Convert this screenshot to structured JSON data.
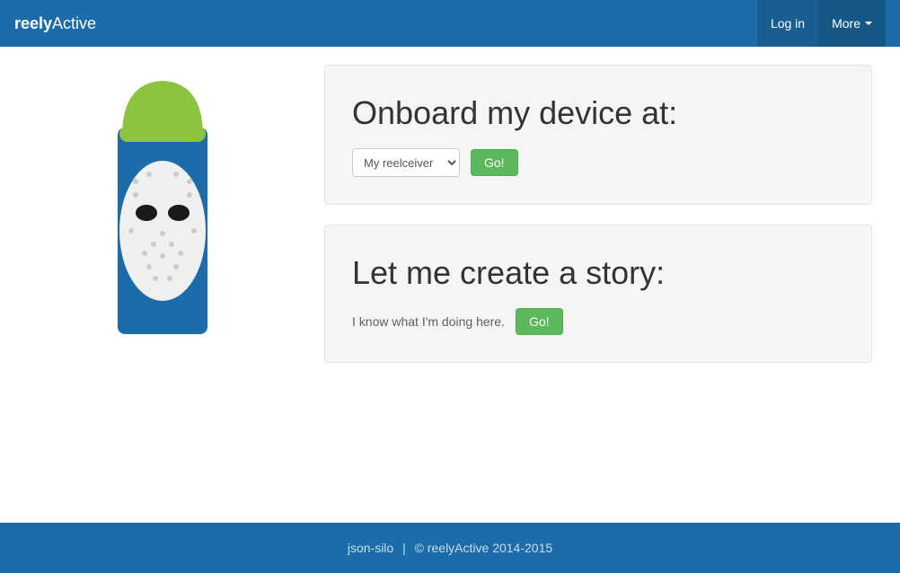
{
  "navbar": {
    "brand_bold": "reely",
    "brand_rest": "Active",
    "login": "Log in",
    "more": "More"
  },
  "panel1": {
    "title": "Onboard my device at:",
    "select_value": "My reelceiver",
    "go": "Go!"
  },
  "panel2": {
    "title": "Let me create a story:",
    "text": "I know what I'm doing here.",
    "go": "Go!"
  },
  "footer": {
    "left": "json-silo",
    "sep": "|",
    "right": "© reelyActive 2014-2015"
  },
  "colors": {
    "navbar": "#1b6ca8",
    "panel_bg": "#f5f5f5",
    "btn_success": "#5cb85c"
  }
}
